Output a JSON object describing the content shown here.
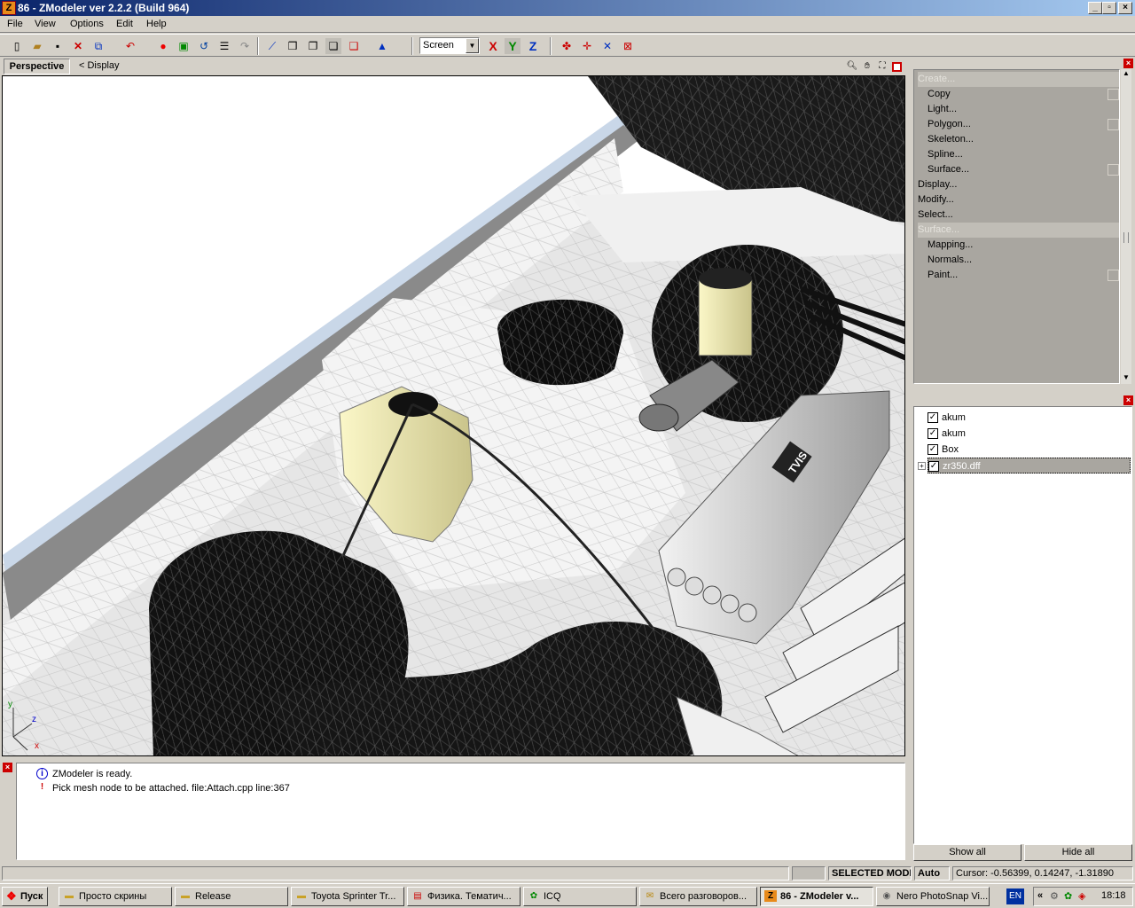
{
  "window": {
    "title": "86 - ZModeler ver 2.2.2 (Build 964)",
    "app_icon": "Z"
  },
  "menu": [
    "File",
    "View",
    "Options",
    "Edit",
    "Help"
  ],
  "toolbar": {
    "combo_value": "Screen",
    "axis_x": "X",
    "axis_y": "Y",
    "axis_z": "Z",
    "icons": [
      "new-icon",
      "open-icon",
      "save-icon",
      "delete-icon",
      "copy-icon",
      "undo-icon",
      "record-icon",
      "render-icon",
      "rotate-icon",
      "list-icon",
      "redo-icon"
    ]
  },
  "viewport": {
    "tab": "Perspective",
    "breadcrumb": "< Display",
    "axis_labels": {
      "y": "y",
      "z": "z",
      "x": "x"
    }
  },
  "commands": [
    {
      "label": "Create...",
      "kind": "head"
    },
    {
      "label": "Copy",
      "kind": "sub",
      "box": true
    },
    {
      "label": "Light...",
      "kind": "sub",
      "box": false
    },
    {
      "label": "Polygon...",
      "kind": "sub",
      "box": true
    },
    {
      "label": "Skeleton...",
      "kind": "sub",
      "box": false
    },
    {
      "label": "Spline...",
      "kind": "sub",
      "box": false
    },
    {
      "label": "Surface...",
      "kind": "sub",
      "box": true
    },
    {
      "label": "Display...",
      "kind": "top",
      "box": false
    },
    {
      "label": "Modify...",
      "kind": "top",
      "box": false
    },
    {
      "label": "Select...",
      "kind": "top",
      "box": false
    },
    {
      "label": "Surface...",
      "kind": "head"
    },
    {
      "label": "Mapping...",
      "kind": "sub",
      "box": false
    },
    {
      "label": "Normals...",
      "kind": "sub",
      "box": false
    },
    {
      "label": "Paint...",
      "kind": "sub",
      "box": true
    }
  ],
  "tree": [
    {
      "label": "akum",
      "checked": true,
      "selected": false,
      "expander": false
    },
    {
      "label": "akum",
      "checked": true,
      "selected": false,
      "expander": false
    },
    {
      "label": "Box",
      "checked": true,
      "selected": false,
      "expander": false
    },
    {
      "label": "zr350.dff",
      "checked": true,
      "selected": true,
      "expander": true
    }
  ],
  "tree_buttons": {
    "show_all": "Show all",
    "hide_all": "Hide all"
  },
  "log": [
    {
      "icon": "info-icon",
      "text": "ZModeler is ready."
    },
    {
      "icon": "warning-icon",
      "text": "Pick mesh node to be attached. file:Attach.cpp line:367"
    }
  ],
  "status": {
    "mode": "SELECTED MODE",
    "auto": "Auto",
    "cursor": "Cursor: -0.56399, 0.14247, -1.31890"
  },
  "taskbar": {
    "start": "Пуск",
    "tasks": [
      {
        "label": "Просто скрины",
        "icon": "folder-icon",
        "active": false
      },
      {
        "label": "Release",
        "icon": "folder-icon",
        "active": false
      },
      {
        "label": "Toyota Sprinter Tr...",
        "icon": "folder-icon",
        "active": false
      },
      {
        "label": "Физика. Тематич...",
        "icon": "pdf-icon",
        "active": false
      },
      {
        "label": "ICQ",
        "icon": "icq-icon",
        "active": false
      },
      {
        "label": "Всего разговоров...",
        "icon": "chat-icon",
        "active": false
      },
      {
        "label": "86 - ZModeler v...",
        "icon": "zmodeler-icon",
        "active": true
      },
      {
        "label": "Nero PhotoSnap Vi...",
        "icon": "nero-icon",
        "active": false
      }
    ],
    "lang": "EN",
    "clock": "18:18"
  },
  "colors": {
    "title_start": "#0a246a",
    "title_end": "#a6caf0",
    "panel_bg": "#d4d0c8",
    "cmd_bg": "#a9a6a0",
    "close_red": "#cc0000"
  }
}
